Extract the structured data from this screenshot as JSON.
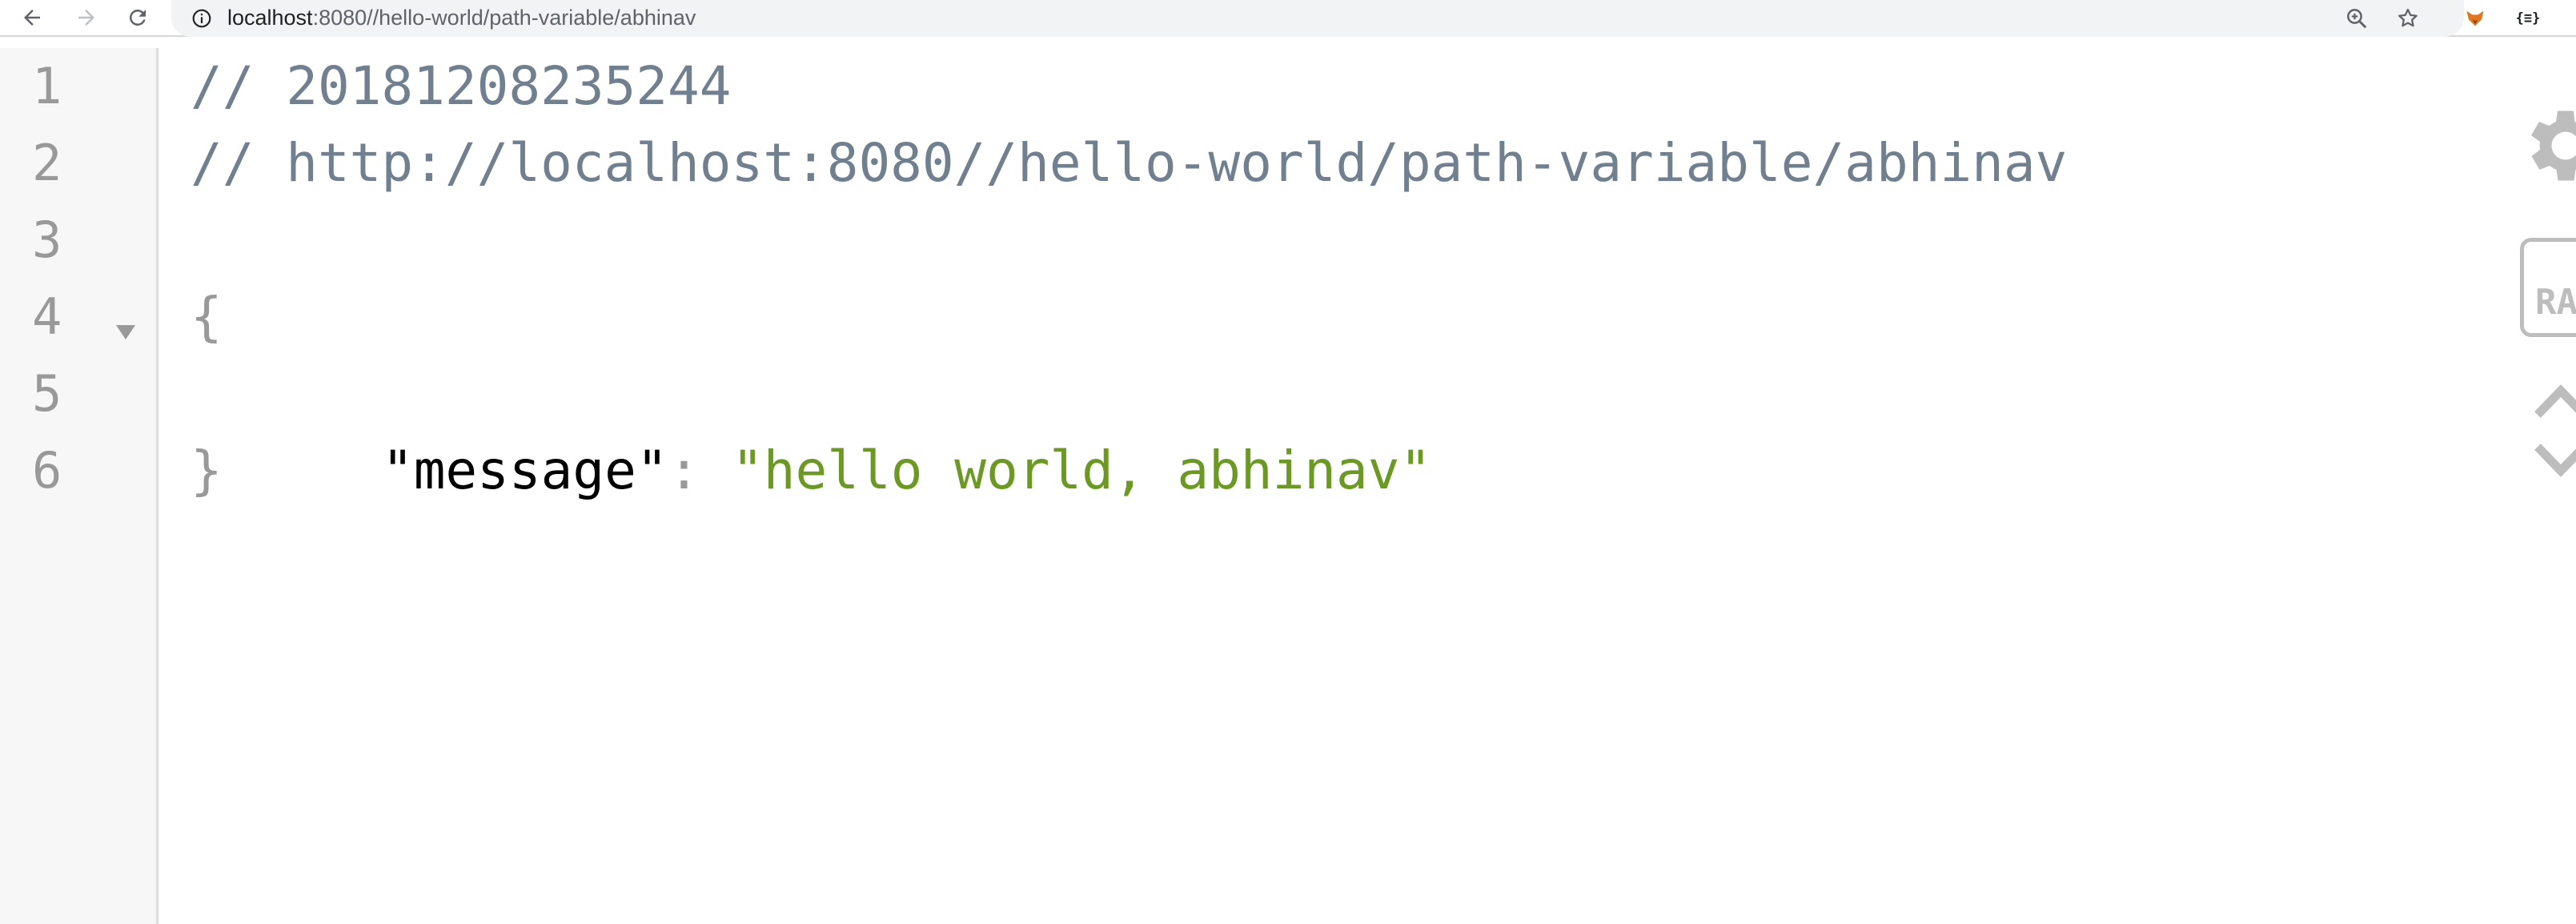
{
  "browser": {
    "address_bar": {
      "host": "localhost",
      "path": ":8080//hello-world/path-variable/abhinav"
    },
    "icons": {
      "back": "arrow-left-icon",
      "forward": "arrow-right-icon",
      "reload": "reload-icon",
      "site_info": "info-icon",
      "zoom": "zoom-icon",
      "bookmark": "star-icon",
      "extension_1": "fox-extension-icon",
      "extension_2": "json-extension-icon"
    },
    "extension_2_label": "{≡}"
  },
  "editor": {
    "lines": [
      {
        "number": "1"
      },
      {
        "number": "2"
      },
      {
        "number": "3"
      },
      {
        "number": "4"
      },
      {
        "number": "5"
      },
      {
        "number": "6"
      }
    ],
    "code": {
      "line1_comment": "// 20181208235244",
      "line2_comment": "// http://localhost:8080//hello-world/path-variable/abhinav",
      "line4_open_brace": "{",
      "line5_key": "\"message\"",
      "line5_colon": ": ",
      "line5_value": "\"hello world, abhinav\"",
      "line6_close_brace": "}"
    }
  },
  "viewer_controls": {
    "raw_button_label": "RAW",
    "icons": {
      "settings": "gear-icon",
      "collapse": "chevron-up-icon",
      "expand": "chevron-down-icon"
    }
  },
  "colors": {
    "comment": "#708090",
    "string": "#6a9a1f",
    "key": "#000000",
    "punctuation": "#999999",
    "gutter_bg": "#f7f7f7"
  }
}
